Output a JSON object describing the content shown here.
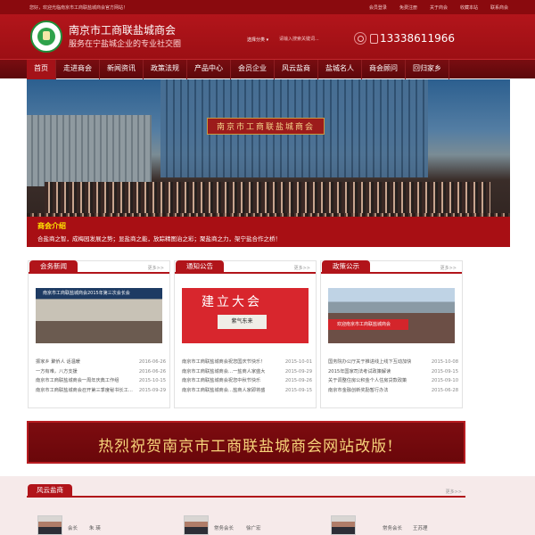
{
  "topbar": {
    "welcome": "您好，欢迎光临南京市工商联盐城商会官方网站！",
    "links": [
      "会员登录",
      "免费注册",
      "关于商会",
      "收藏本站",
      "联系商会"
    ]
  },
  "header": {
    "title": "南京市工商联盐城商会",
    "subtitle": "服务在宁盐城企业的专业社交圈",
    "search_category": "选择分类 ▾",
    "search_placeholder": "请输入搜索关键词...",
    "phone": "13338611966"
  },
  "nav": [
    "首页",
    "走进商会",
    "新闻资讯",
    "政策法规",
    "产品中心",
    "会员企业",
    "风云盐商",
    "盐城名人",
    "商会顾问",
    "回归家乡"
  ],
  "banner": {
    "sign": "南京市工商联盐城商会",
    "caption_title": "商会介绍",
    "caption_text": "合盐商之智，成梅园发展之势；显盐商之能，放踪精图治之彩；聚盐商之力，架宁盐合作之桥！"
  },
  "columns": [
    {
      "title": "会务新闻",
      "more": "更多>>",
      "image_text": "南京市工商联盐城商会2015年第三次会长会",
      "items": [
        {
          "title": "振家乡 聚侨人 话温暖",
          "date": "2016-06-26"
        },
        {
          "title": "一方有难，八方支援",
          "date": "2016-06-26"
        },
        {
          "title": "南京市工商联盐城商会一周年庆典工作组",
          "date": "2015-10-15"
        },
        {
          "title": "南京市工商联盐城商会召开第三季度秘书长工作会",
          "date": "2015-09-29"
        }
      ]
    },
    {
      "title": "通知公告",
      "more": "更多>>",
      "image_text": "建立大会",
      "image_sub": "紫气东来",
      "items": [
        {
          "title": "南京市工商联盐城商会祝您国庆节快乐！",
          "date": "2015-10-01"
        },
        {
          "title": "南京市工商联盐城商会…一盐商人家盛大",
          "date": "2015-09-29"
        },
        {
          "title": "南京市工商联盐城商会祝您中秋节快乐",
          "date": "2015-09-26"
        },
        {
          "title": "南京市工商联盐城商会…盐商人家即将盛",
          "date": "2015-09-15"
        }
      ]
    },
    {
      "title": "政策公示",
      "more": "更多>>",
      "image_text": "欢迎南京市工商联盐城商会",
      "items": [
        {
          "title": "国务院办公厅关于推进线上线下互动加快",
          "date": "2015-10-08"
        },
        {
          "title": "2015年国家司法考试政策解读",
          "date": "2015-09-15"
        },
        {
          "title": "关于调整住房公积金个人住房贷款政策",
          "date": "2015-09-10"
        },
        {
          "title": "南京市金融创新奖励暂行办法",
          "date": "2015-06-28"
        }
      ]
    }
  ],
  "congrats": "热烈祝贺南京市工商联盐城商会网站改版!",
  "leaders_section": {
    "title": "风云盐商",
    "more": "更多>>",
    "leaders": [
      {
        "role": "会长",
        "name": "朱 瑛"
      },
      {
        "role": "常务会长",
        "name": "徐广宏"
      },
      {
        "role": "常务会长",
        "name": "王苏理"
      }
    ]
  },
  "colors": {
    "primary": "#b1141a",
    "dark": "#7a0d11",
    "accent_yellow": "#ffe600",
    "gold": "#f6d37a"
  }
}
